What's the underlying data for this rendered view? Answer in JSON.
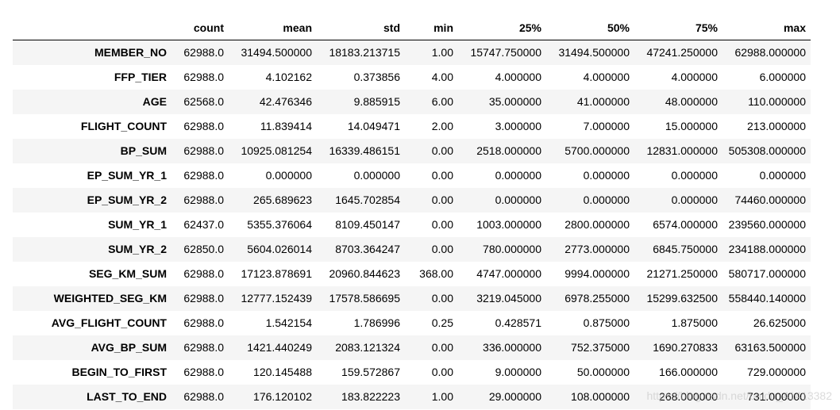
{
  "table": {
    "columns": [
      "",
      "count",
      "mean",
      "std",
      "min",
      "25%",
      "50%",
      "75%",
      "max"
    ],
    "rows": [
      {
        "index": "MEMBER_NO",
        "values": [
          "62988.0",
          "31494.500000",
          "18183.213715",
          "1.00",
          "15747.750000",
          "31494.500000",
          "47241.250000",
          "62988.000000"
        ]
      },
      {
        "index": "FFP_TIER",
        "values": [
          "62988.0",
          "4.102162",
          "0.373856",
          "4.00",
          "4.000000",
          "4.000000",
          "4.000000",
          "6.000000"
        ]
      },
      {
        "index": "AGE",
        "values": [
          "62568.0",
          "42.476346",
          "9.885915",
          "6.00",
          "35.000000",
          "41.000000",
          "48.000000",
          "110.000000"
        ]
      },
      {
        "index": "FLIGHT_COUNT",
        "values": [
          "62988.0",
          "11.839414",
          "14.049471",
          "2.00",
          "3.000000",
          "7.000000",
          "15.000000",
          "213.000000"
        ]
      },
      {
        "index": "BP_SUM",
        "values": [
          "62988.0",
          "10925.081254",
          "16339.486151",
          "0.00",
          "2518.000000",
          "5700.000000",
          "12831.000000",
          "505308.000000"
        ]
      },
      {
        "index": "EP_SUM_YR_1",
        "values": [
          "62988.0",
          "0.000000",
          "0.000000",
          "0.00",
          "0.000000",
          "0.000000",
          "0.000000",
          "0.000000"
        ]
      },
      {
        "index": "EP_SUM_YR_2",
        "values": [
          "62988.0",
          "265.689623",
          "1645.702854",
          "0.00",
          "0.000000",
          "0.000000",
          "0.000000",
          "74460.000000"
        ]
      },
      {
        "index": "SUM_YR_1",
        "values": [
          "62437.0",
          "5355.376064",
          "8109.450147",
          "0.00",
          "1003.000000",
          "2800.000000",
          "6574.000000",
          "239560.000000"
        ]
      },
      {
        "index": "SUM_YR_2",
        "values": [
          "62850.0",
          "5604.026014",
          "8703.364247",
          "0.00",
          "780.000000",
          "2773.000000",
          "6845.750000",
          "234188.000000"
        ]
      },
      {
        "index": "SEG_KM_SUM",
        "values": [
          "62988.0",
          "17123.878691",
          "20960.844623",
          "368.00",
          "4747.000000",
          "9994.000000",
          "21271.250000",
          "580717.000000"
        ]
      },
      {
        "index": "WEIGHTED_SEG_KM",
        "values": [
          "62988.0",
          "12777.152439",
          "17578.586695",
          "0.00",
          "3219.045000",
          "6978.255000",
          "15299.632500",
          "558440.140000"
        ]
      },
      {
        "index": "AVG_FLIGHT_COUNT",
        "values": [
          "62988.0",
          "1.542154",
          "1.786996",
          "0.25",
          "0.428571",
          "0.875000",
          "1.875000",
          "26.625000"
        ]
      },
      {
        "index": "AVG_BP_SUM",
        "values": [
          "62988.0",
          "1421.440249",
          "2083.121324",
          "0.00",
          "336.000000",
          "752.375000",
          "1690.270833",
          "63163.500000"
        ]
      },
      {
        "index": "BEGIN_TO_FIRST",
        "values": [
          "62988.0",
          "120.145488",
          "159.572867",
          "0.00",
          "9.000000",
          "50.000000",
          "166.000000",
          "729.000000"
        ]
      },
      {
        "index": "LAST_TO_END",
        "values": [
          "62988.0",
          "176.120102",
          "183.822223",
          "1.00",
          "29.000000",
          "108.000000",
          "268.000000",
          "731.000000"
        ]
      }
    ]
  },
  "watermark": "https://blog.csdn.net/baidu_41413382",
  "colors": {
    "stripe": "#f5f5f5",
    "background": "#ffffff",
    "header_border": "#000000"
  }
}
